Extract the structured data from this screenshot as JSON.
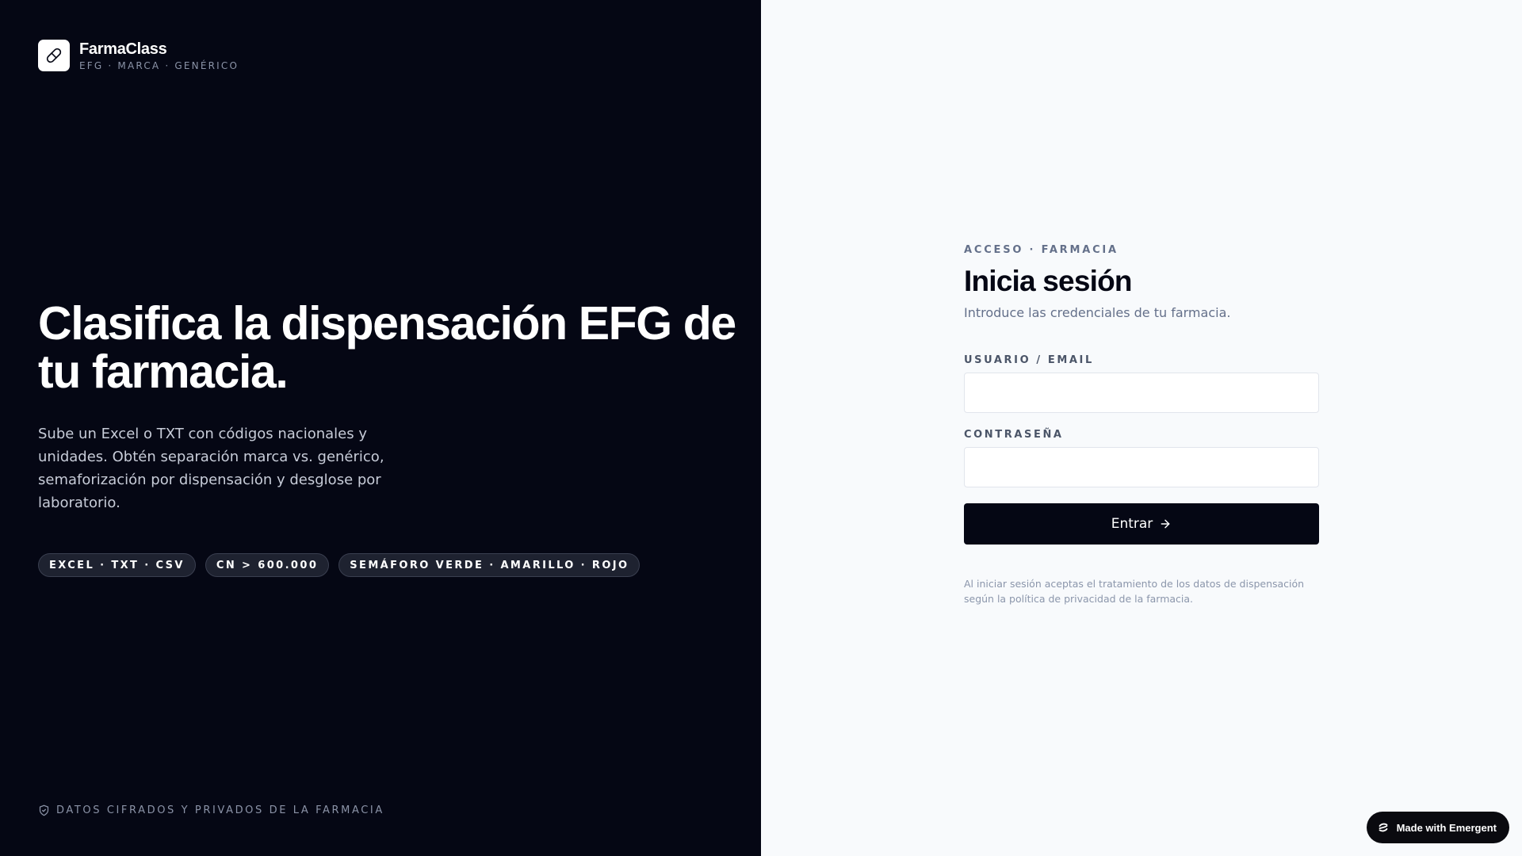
{
  "brand": {
    "name": "FarmaClass",
    "tagline": "EFG · MARCA · GENÉRICO",
    "logo_icon": "pill-icon"
  },
  "hero": {
    "title": "Clasifica la dispensación EFG de tu farmacia.",
    "description": "Sube un Excel o TXT con códigos nacionales y unidades. Obtén separación marca vs. genérico, semaforización por dispensación y desglose por laboratorio."
  },
  "pills": [
    "EXCEL · TXT · CSV",
    "CN > 600.000",
    "SEMÁFORO VERDE · AMARILLO · ROJO"
  ],
  "footer": {
    "secure_text": "DATOS CIFRADOS Y PRIVADOS DE LA FARMACIA",
    "secure_icon": "shield-icon"
  },
  "login": {
    "eyebrow": "ACCESO · FARMACIA",
    "title": "Inicia sesión",
    "subtitle": "Introduce las credenciales de tu farmacia.",
    "user_label": "USUARIO / EMAIL",
    "user_value": "",
    "password_label": "CONTRASEÑA",
    "password_value": "",
    "submit_label": "Entrar",
    "submit_icon": "arrow-right-icon",
    "legal": "Al iniciar sesión aceptas el tratamiento de los datos de dispensación según la política de privacidad de la farmacia."
  },
  "badge": {
    "label": "Made with Emergent",
    "icon": "emergent-logo-icon"
  },
  "colors": {
    "dark_panel": "#050714",
    "light_panel": "#f8fafc",
    "muted_text": "#64708a",
    "pill_background": "#1e2230"
  }
}
